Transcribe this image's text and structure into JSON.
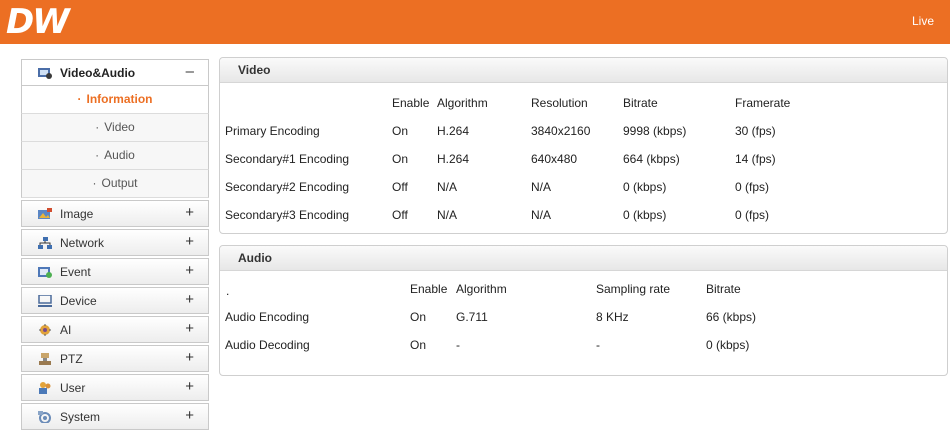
{
  "header": {
    "logo": "DW",
    "live_label": "Live"
  },
  "sidebar": {
    "video_audio": {
      "label": "Video&Audio",
      "toggle": "–",
      "items": [
        "Information",
        "Video",
        "Audio",
        "Output"
      ],
      "active": "Information"
    },
    "menus": [
      {
        "label": "Image",
        "icon": "image-icon",
        "toggle": "+"
      },
      {
        "label": "Network",
        "icon": "network-icon",
        "toggle": "+"
      },
      {
        "label": "Event",
        "icon": "event-icon",
        "toggle": "+"
      },
      {
        "label": "Device",
        "icon": "device-icon",
        "toggle": "+"
      },
      {
        "label": "AI",
        "icon": "ai-icon",
        "toggle": "+"
      },
      {
        "label": "PTZ",
        "icon": "ptz-icon",
        "toggle": "+"
      },
      {
        "label": "User",
        "icon": "user-icon",
        "toggle": "+"
      },
      {
        "label": "System",
        "icon": "system-icon",
        "toggle": "+"
      }
    ],
    "bullet": "·"
  },
  "video": {
    "title": "Video",
    "headers": [
      "Enable",
      "Algorithm",
      "Resolution",
      "Bitrate",
      "Framerate"
    ],
    "rows": [
      [
        "Primary Encoding",
        "On",
        "H.264",
        "3840x2160",
        "9998 (kbps)",
        "30 (fps)"
      ],
      [
        "Secondary#1 Encoding",
        "On",
        "H.264",
        "640x480",
        "664 (kbps)",
        "14 (fps)"
      ],
      [
        "Secondary#2 Encoding",
        "Off",
        "N/A",
        "N/A",
        "0 (kbps)",
        "0 (fps)"
      ],
      [
        "Secondary#3 Encoding",
        "Off",
        "N/A",
        "N/A",
        "0 (kbps)",
        "0 (fps)"
      ]
    ]
  },
  "audio": {
    "title": "Audio",
    "corner_mark": ".",
    "headers": [
      "Enable",
      "Algorithm",
      "Sampling rate",
      "Bitrate"
    ],
    "rows": [
      [
        "Audio Encoding",
        "On",
        "G.711",
        "8 KHz",
        "66 (kbps)"
      ],
      [
        "Audio Decoding",
        "On",
        "-",
        "-",
        "0 (kbps)"
      ]
    ]
  },
  "colors": {
    "accent": "#ec6f23",
    "border": "#cfcfcf"
  }
}
